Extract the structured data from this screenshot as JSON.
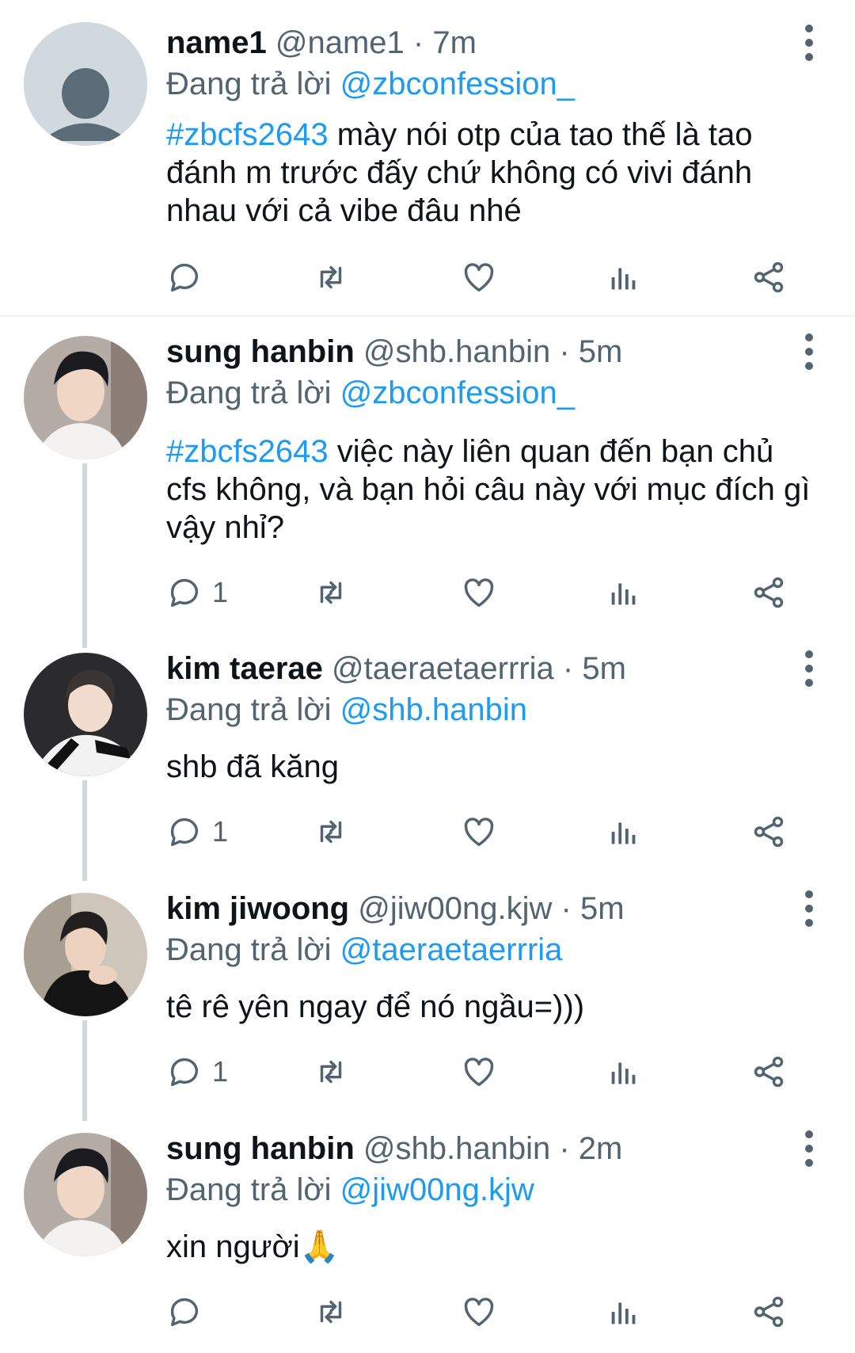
{
  "replying_prefix": "Đang trả lời",
  "tweets": [
    {
      "name": "name1",
      "handle": "@name1",
      "dot": "·",
      "time": "7m",
      "replying_to": "@zbconfession_",
      "hashtag": "#zbcfs2643",
      "text": " mày nói otp của tao thế là tao đánh m trước đấy chứ không có vivi đánh nhau với cả vibe đâu nhé",
      "reply_count": "",
      "avatar": "default-avatar"
    },
    {
      "name": "sung hanbin",
      "handle": "@shb.hanbin",
      "dot": "·",
      "time": "5m",
      "replying_to": "@zbconfession_",
      "hashtag": "#zbcfs2643",
      "text": " việc này liên quan đến bạn chủ cfs không, và bạn hỏi câu này với mục đích gì vậy nhỉ?",
      "reply_count": "1",
      "avatar": "photo-avatar"
    },
    {
      "name": "kim taerae",
      "handle": "@taeraetaerrria",
      "dot": "·",
      "time": "5m",
      "replying_to": "@shb.hanbin",
      "hashtag": "",
      "text": "shb đã kăng",
      "reply_count": "1",
      "avatar": "photo-avatar"
    },
    {
      "name": "kim jiwoong",
      "handle": "@jiw00ng.kjw",
      "dot": "·",
      "time": "5m",
      "replying_to": "@taeraetaerrria",
      "hashtag": "",
      "text": "tê rê yên ngay để nó ngầu=)))",
      "reply_count": "1",
      "avatar": "photo-avatar"
    },
    {
      "name": "sung hanbin",
      "handle": "@shb.hanbin",
      "dot": "·",
      "time": "2m",
      "replying_to": "@jiw00ng.kjw",
      "hashtag": "",
      "text": "xin người🙏",
      "reply_count": "",
      "avatar": "photo-avatar"
    }
  ],
  "colors": {
    "accent": "#1d9bf0",
    "muted": "#536471",
    "text": "#0f1419",
    "thread_line": "#cfd9de"
  },
  "icons": [
    "more-vertical-icon",
    "reply-icon",
    "retweet-icon",
    "like-icon",
    "analytics-icon",
    "share-icon"
  ]
}
